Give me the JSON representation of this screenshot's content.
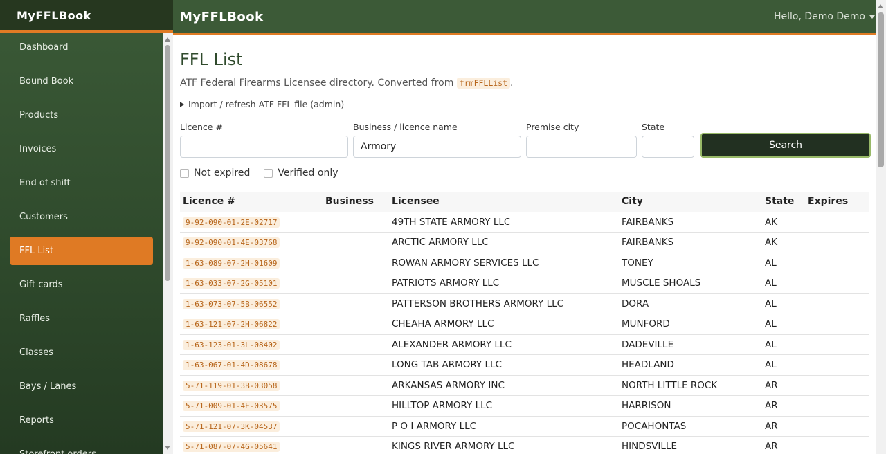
{
  "brand": "MyFFLBook",
  "nav": [
    {
      "label": "Dashboard",
      "active": false
    },
    {
      "label": "Bound Book",
      "active": false
    },
    {
      "label": "Products",
      "active": false
    },
    {
      "label": "Invoices",
      "active": false
    },
    {
      "label": "End of shift",
      "active": false
    },
    {
      "label": "Customers",
      "active": false
    },
    {
      "label": "FFL List",
      "active": true
    },
    {
      "label": "Gift cards",
      "active": false
    },
    {
      "label": "Raffles",
      "active": false
    },
    {
      "label": "Classes",
      "active": false
    },
    {
      "label": "Bays / Lanes",
      "active": false
    },
    {
      "label": "Reports",
      "active": false
    },
    {
      "label": "Storefront orders",
      "active": false
    }
  ],
  "topbar": {
    "title": "MyFFLBook",
    "user": "Hello, Demo Demo"
  },
  "page": {
    "title": "FFL List",
    "desc_prefix": "ATF Federal Firearms Licensee directory. Converted from",
    "desc_code": "frmFFLList",
    "desc_suffix": ".",
    "import_label": "Import / refresh ATF FFL file (admin)"
  },
  "search": {
    "licence_label": "Licence #",
    "licence_value": "",
    "name_label": "Business / licence name",
    "name_value": "Armory",
    "city_label": "Premise city",
    "city_value": "",
    "state_label": "State",
    "state_value": "",
    "button": "Search",
    "not_expired": "Not expired",
    "verified_only": "Verified only"
  },
  "table": {
    "headers": [
      "Licence #",
      "Business",
      "Licensee",
      "City",
      "State",
      "Expires"
    ],
    "rows": [
      {
        "licence": "9-92-090-01-2E-02717",
        "business": "",
        "licensee": "49TH STATE ARMORY LLC",
        "city": "FAIRBANKS",
        "state": "AK",
        "expires": ""
      },
      {
        "licence": "9-92-090-01-4E-03768",
        "business": "",
        "licensee": "ARCTIC ARMORY LLC",
        "city": "FAIRBANKS",
        "state": "AK",
        "expires": ""
      },
      {
        "licence": "1-63-089-07-2H-01609",
        "business": "",
        "licensee": "ROWAN ARMORY SERVICES LLC",
        "city": "TONEY",
        "state": "AL",
        "expires": ""
      },
      {
        "licence": "1-63-033-07-2G-05101",
        "business": "",
        "licensee": "PATRIOTS ARMORY LLC",
        "city": "MUSCLE SHOALS",
        "state": "AL",
        "expires": ""
      },
      {
        "licence": "1-63-073-07-5B-06552",
        "business": "",
        "licensee": "PATTERSON BROTHERS ARMORY LLC",
        "city": "DORA",
        "state": "AL",
        "expires": ""
      },
      {
        "licence": "1-63-121-07-2H-06822",
        "business": "",
        "licensee": "CHEAHA ARMORY LLC",
        "city": "MUNFORD",
        "state": "AL",
        "expires": ""
      },
      {
        "licence": "1-63-123-01-3L-08402",
        "business": "",
        "licensee": "ALEXANDER ARMORY LLC",
        "city": "DADEVILLE",
        "state": "AL",
        "expires": ""
      },
      {
        "licence": "1-63-067-01-4D-08678",
        "business": "",
        "licensee": "LONG TAB ARMORY LLC",
        "city": "HEADLAND",
        "state": "AL",
        "expires": ""
      },
      {
        "licence": "5-71-119-01-3B-03058",
        "business": "",
        "licensee": "ARKANSAS ARMORY INC",
        "city": "NORTH LITTLE ROCK",
        "state": "AR",
        "expires": ""
      },
      {
        "licence": "5-71-009-01-4E-03575",
        "business": "",
        "licensee": "HILLTOP ARMORY LLC",
        "city": "HARRISON",
        "state": "AR",
        "expires": ""
      },
      {
        "licence": "5-71-121-07-3K-04537",
        "business": "",
        "licensee": "P O I ARMORY LLC",
        "city": "POCAHONTAS",
        "state": "AR",
        "expires": ""
      },
      {
        "licence": "5-71-087-07-4G-05641",
        "business": "",
        "licensee": "KINGS RIVER ARMORY LLC",
        "city": "HINDSVILLE",
        "state": "AR",
        "expires": ""
      }
    ]
  }
}
